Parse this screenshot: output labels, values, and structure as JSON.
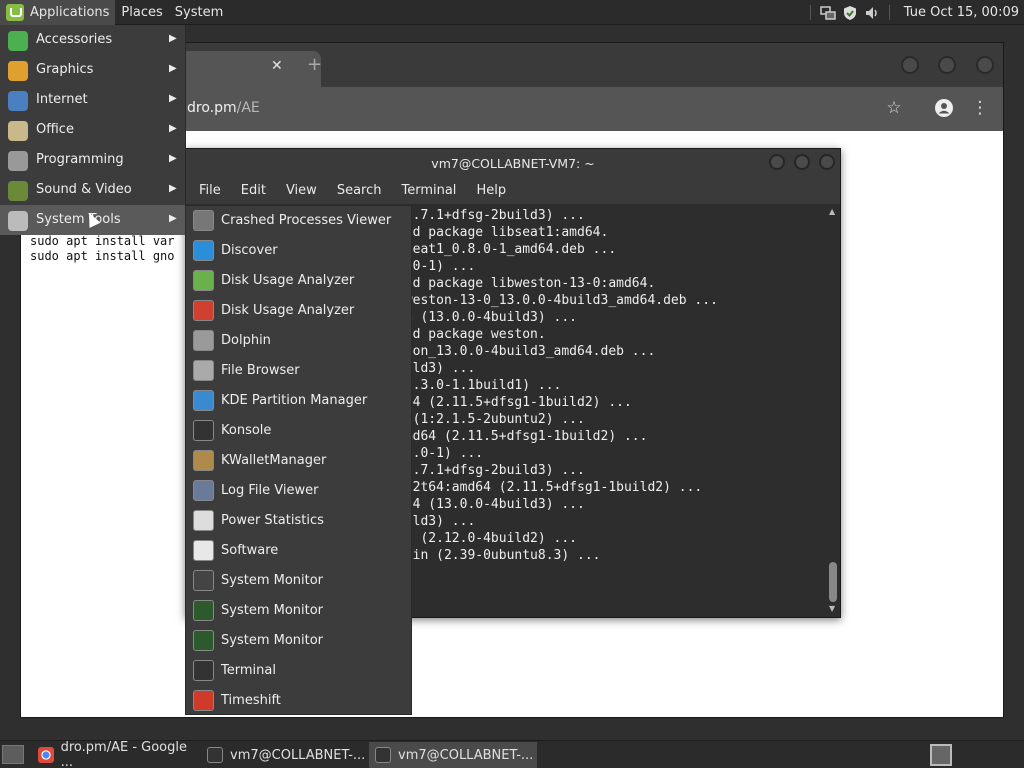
{
  "top_panel": {
    "applications_label": "Applications",
    "places_label": "Places",
    "system_label": "System",
    "clock": "Tue Oct 15, 00:09"
  },
  "browser": {
    "url_host": "dro.pm",
    "url_path": "/AE",
    "page_lines": [
      "sudo apt install var",
      "sudo apt install gno"
    ]
  },
  "terminal": {
    "title": "vm7@COLLABNET-VM7: ~",
    "menu": [
      "File",
      "Edit",
      "View",
      "Search",
      "Terminal",
      "Help"
    ],
    "lines": [
      "(0.7.1+dfsg-2build3) ...",
      "ted package libseat1:amd64.",
      "bseat1_0.8.0-1_amd64.deb ...",
      "8.0-1) ...",
      "ted package libweston-13-0:amd64.",
      "bweston-13-0_13.0.0-4build3_amd64.deb ...",
      "64 (13.0.0-4build3) ...",
      "ted package weston.",
      "ston_13.0.0-4build3_amd64.deb ...",
      "uild3) ...",
      "(0.3.0-1.1build1) ...",
      "d64 (2.11.5+dfsg1-1build2) ...",
      "4 (1:2.1.5-2ubuntu2) ...",
      "amd64 (2.11.5+dfsg1-1build2) ...",
      ".8.0-1) ...",
      "(0.7.1+dfsg-2build3) ...",
      "2-2t64:amd64 (2.11.5+dfsg1-1build2) ...",
      "d64 (13.0.0-4build3) ...",
      "uild3) ...",
      "db (2.12.0-4build2) ...",
      "-bin (2.39-0ubuntu8.3) ..."
    ]
  },
  "app_menu": {
    "categories": [
      {
        "label": "Accessories",
        "icon": "accessories-icon",
        "color": "#4caf50"
      },
      {
        "label": "Graphics",
        "icon": "graphics-icon",
        "color": "#e0a030"
      },
      {
        "label": "Internet",
        "icon": "internet-icon",
        "color": "#4a7fc0"
      },
      {
        "label": "Office",
        "icon": "office-icon",
        "color": "#c8b88a"
      },
      {
        "label": "Programming",
        "icon": "programming-icon",
        "color": "#999999"
      },
      {
        "label": "Sound & Video",
        "icon": "sound-video-icon",
        "color": "#6a8a3a"
      },
      {
        "label": "System Tools",
        "icon": "system-tools-icon",
        "color": "#bbbbbb"
      }
    ],
    "system_tools": [
      {
        "label": "Crashed Processes Viewer",
        "icon": "crash-viewer-icon",
        "color": "#777777"
      },
      {
        "label": "Discover",
        "icon": "discover-icon",
        "color": "#2a8fd8"
      },
      {
        "label": "Disk Usage Analyzer",
        "icon": "disk-usage-icon",
        "color": "#6ab04c"
      },
      {
        "label": "Disk Usage Analyzer",
        "icon": "disk-usage-alt-icon",
        "color": "#d04030"
      },
      {
        "label": "Dolphin",
        "icon": "dolphin-icon",
        "color": "#9a9a9a"
      },
      {
        "label": "File Browser",
        "icon": "file-browser-icon",
        "color": "#aaaaaa"
      },
      {
        "label": "KDE Partition Manager",
        "icon": "partition-manager-icon",
        "color": "#3a8ad0"
      },
      {
        "label": "Konsole",
        "icon": "konsole-icon",
        "color": "#333333"
      },
      {
        "label": "KWalletManager",
        "icon": "kwallet-icon",
        "color": "#b08a4a"
      },
      {
        "label": "Log File Viewer",
        "icon": "log-viewer-icon",
        "color": "#6a7a9a"
      },
      {
        "label": "Power Statistics",
        "icon": "power-stats-icon",
        "color": "#dddddd"
      },
      {
        "label": "Software",
        "icon": "software-icon",
        "color": "#e8e8e8"
      },
      {
        "label": "System Monitor",
        "icon": "system-monitor-icon",
        "color": "#444444"
      },
      {
        "label": "System Monitor",
        "icon": "system-monitor-alt-icon",
        "color": "#2d5a2d"
      },
      {
        "label": "System Monitor",
        "icon": "system-monitor-alt2-icon",
        "color": "#2d5a2d"
      },
      {
        "label": "Terminal",
        "icon": "terminal-icon",
        "color": "#333333"
      },
      {
        "label": "Timeshift",
        "icon": "timeshift-icon",
        "color": "#d03a2a"
      }
    ]
  },
  "taskbar": {
    "tasks": [
      {
        "label": "dro.pm/AE - Google ...",
        "icon": "chrome-icon"
      },
      {
        "label": "vm7@COLLABNET-...",
        "icon": "terminal-icon"
      },
      {
        "label": "vm7@COLLABNET-...",
        "icon": "terminal-icon"
      }
    ]
  },
  "colors": {
    "panel_bg": "#2b2b2b",
    "menu_bg": "#3c3c3c",
    "mint_green": "#86be43"
  }
}
